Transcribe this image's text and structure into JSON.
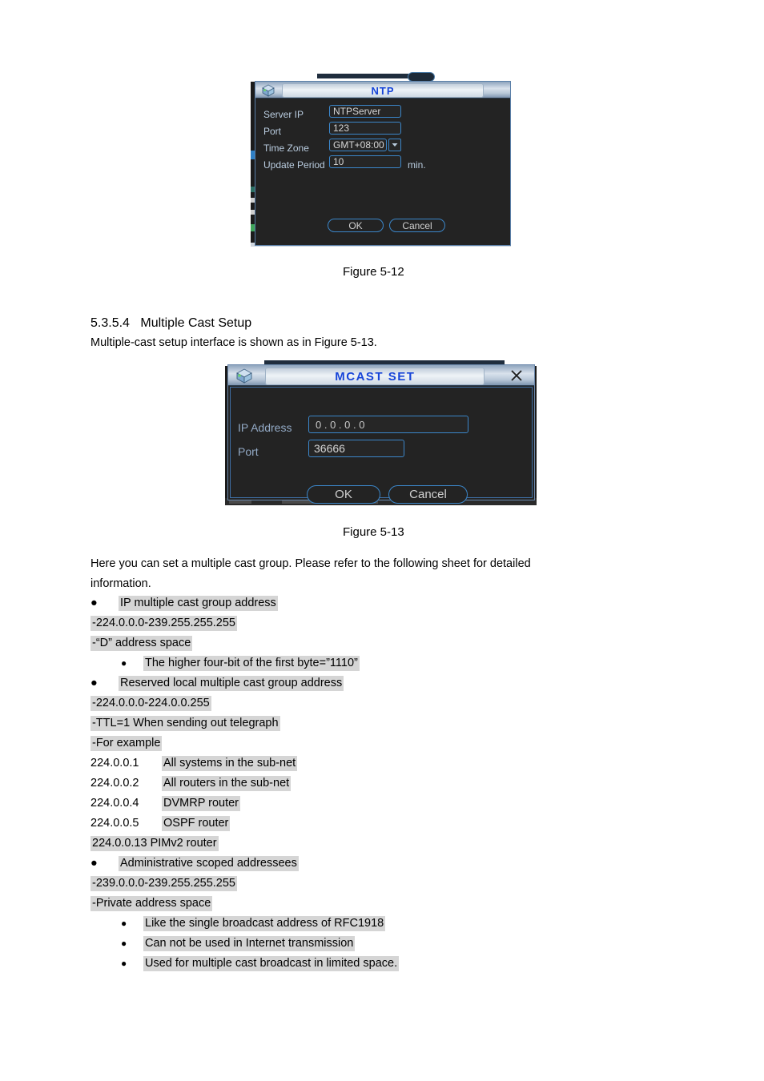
{
  "document": {
    "figure_12_caption": "Figure 5-12",
    "figure_13_caption": "Figure 5-13",
    "section_number": "5.3.5.4",
    "section_title": "Multiple Cast Setup",
    "intro_line": "Multiple-cast setup interface is shown as in Figure 5-13.",
    "body_line_1": "Here you can set a multiple cast group. Please refer to the following sheet for detailed",
    "body_line_2": "information.",
    "items": [
      {
        "level": "bullet1",
        "text": "IP multiple cast group address",
        "highlight": true
      },
      {
        "level": "plain",
        "text": "-224.0.0.0-239.255.255.255",
        "highlight": true
      },
      {
        "level": "plain",
        "text": "-“D” address space",
        "highlight": true
      },
      {
        "level": "bullet2",
        "text": "The higher four-bit of the first byte=”1110”",
        "highlight": true
      },
      {
        "level": "bullet1",
        "text": "Reserved local multiple cast group address",
        "highlight": true
      },
      {
        "level": "plain",
        "text": "-224.0.0.0-224.0.0.255",
        "highlight": true
      },
      {
        "level": "plain",
        "text": "-TTL=1 When sending out telegraph",
        "highlight": true
      },
      {
        "level": "plain",
        "text": "-For example",
        "highlight": true
      },
      {
        "level": "addr",
        "addr": "224.0.0.1",
        "text": "All systems in the sub-net",
        "highlight": true
      },
      {
        "level": "addr",
        "addr": "224.0.0.2",
        "text": "All routers in the sub-net",
        "highlight": true
      },
      {
        "level": "addr",
        "addr": "224.0.0.4",
        "text": "DVMRP router",
        "highlight": true
      },
      {
        "level": "addr",
        "addr": "224.0.0.5",
        "text": "OSPF router",
        "highlight": true
      },
      {
        "level": "plain",
        "text": "224.0.0.13 PIMv2 router",
        "highlight": true
      },
      {
        "level": "bullet1",
        "text": "Administrative scoped addressees",
        "highlight": true
      },
      {
        "level": "plain",
        "text": "-239.0.0.0-239.255.255.255",
        "highlight": true
      },
      {
        "level": "plain",
        "text": "-Private address space",
        "highlight": true
      },
      {
        "level": "bullet2",
        "text": "Like the single broadcast address of RFC1918",
        "highlight": true
      },
      {
        "level": "bullet2",
        "text": "Can not be used in Internet transmission",
        "highlight": true
      },
      {
        "level": "bullet2",
        "text": "Used for multiple cast broadcast in limited space.",
        "highlight": true
      }
    ]
  },
  "ntp_dialog": {
    "title": "NTP",
    "fields": {
      "server_ip_label": "Server IP",
      "server_ip_value": "NTPServer",
      "port_label": "Port",
      "port_value": "123",
      "time_zone_label": "Time Zone",
      "time_zone_value": "GMT+08:00",
      "update_period_label": "Update Period",
      "update_period_value": "10",
      "update_period_suffix": "min."
    },
    "ok_label": "OK",
    "cancel_label": "Cancel"
  },
  "mcast_dialog": {
    "title": "MCAST SET",
    "fields": {
      "ip_address_label": "IP Address",
      "ip_address_value": "0  .  0  .  0  .  0",
      "port_label": "Port",
      "port_value": "36666"
    },
    "ok_label": "OK",
    "cancel_label": "Cancel"
  },
  "colors": {
    "dialog_bg": "#232323",
    "field_border": "#3b86c9",
    "title_text": "#1745d8",
    "label_text": "#8fa8c4",
    "highlight": "#d5d5d5"
  }
}
